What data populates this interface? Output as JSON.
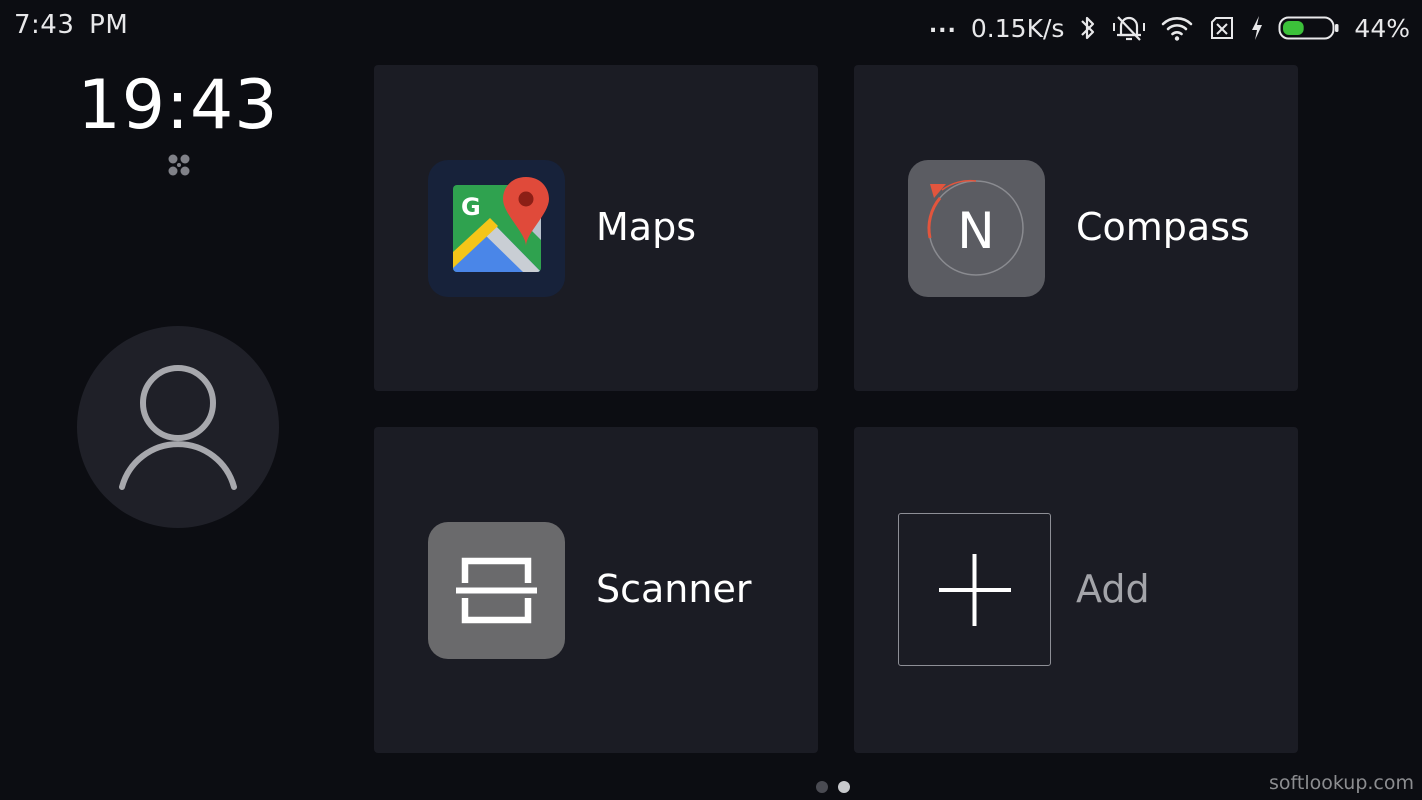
{
  "status_bar": {
    "time": "7:43 PM",
    "dots": "...",
    "network_speed": "0.15K/s",
    "battery_percent": "44%",
    "battery_level": 0.44,
    "icons": [
      "bluetooth-icon",
      "muted-vibrate-icon",
      "wifi-icon",
      "no-sim-icon",
      "charging-icon",
      "battery-icon"
    ]
  },
  "clock": {
    "time": "19:43",
    "weather_icon": "weather-icon"
  },
  "avatar": {
    "icon": "user-icon"
  },
  "apps": [
    {
      "label": "Maps",
      "icon": "google-maps-icon"
    },
    {
      "label": "Compass",
      "icon": "compass-icon"
    },
    {
      "label": "Scanner",
      "icon": "scanner-icon"
    }
  ],
  "add_tile": {
    "label": "Add",
    "icon": "plus-icon"
  },
  "pager": {
    "pages": 2,
    "active": 2
  },
  "watermark": "softlookup.com",
  "colors": {
    "background": "#0c0d12",
    "tile": "#1b1c24",
    "battery_green": "#3cc13a",
    "compass_red": "#e2553d"
  }
}
